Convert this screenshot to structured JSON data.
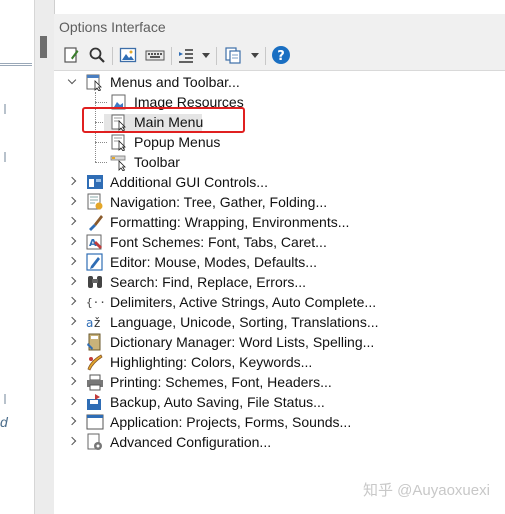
{
  "panel": {
    "title": "Options Interface"
  },
  "toolbar": {
    "buttons": [
      {
        "icon": "edit-document-icon"
      },
      {
        "icon": "search-icon"
      },
      {
        "icon": "image-icon"
      },
      {
        "icon": "keyboard-icon"
      },
      {
        "icon": "indent-icon"
      },
      {
        "icon": "copy-pages-icon"
      },
      {
        "icon": "help-icon",
        "glyph": "?"
      }
    ]
  },
  "tree": {
    "root": {
      "label": "Menus and Toolbar...",
      "expanded": true
    },
    "children": [
      {
        "label": "Image Resources"
      },
      {
        "label": "Main Menu",
        "selected": true
      },
      {
        "label": "Popup Menus"
      },
      {
        "label": "Toolbar"
      }
    ],
    "items": [
      {
        "label": "Additional GUI Controls..."
      },
      {
        "label": "Navigation: Tree, Gather, Folding..."
      },
      {
        "label": "Formatting: Wrapping, Environments..."
      },
      {
        "label": "Font Schemes: Font, Tabs, Caret..."
      },
      {
        "label": "Editor: Mouse, Modes, Defaults..."
      },
      {
        "label": "Search: Find, Replace, Errors..."
      },
      {
        "label": "Delimiters, Active Strings, Auto Complete..."
      },
      {
        "label": "Language, Unicode, Sorting, Translations..."
      },
      {
        "label": "Dictionary Manager: Word Lists, Spelling..."
      },
      {
        "label": "Highlighting: Colors, Keywords..."
      },
      {
        "label": "Printing: Schemes, Font, Headers..."
      },
      {
        "label": "Backup, Auto Saving, File Status..."
      },
      {
        "label": "Application: Projects, Forms, Sounds..."
      },
      {
        "label": "Advanced Configuration..."
      }
    ]
  },
  "left_pane": {
    "letter": "d"
  },
  "watermark": "知乎 @Auyaoxuexi",
  "colors": {
    "highlight_border": "#e02020",
    "toolbar_bg": "#f0f0f0",
    "help_blue": "#1a6fc2"
  }
}
